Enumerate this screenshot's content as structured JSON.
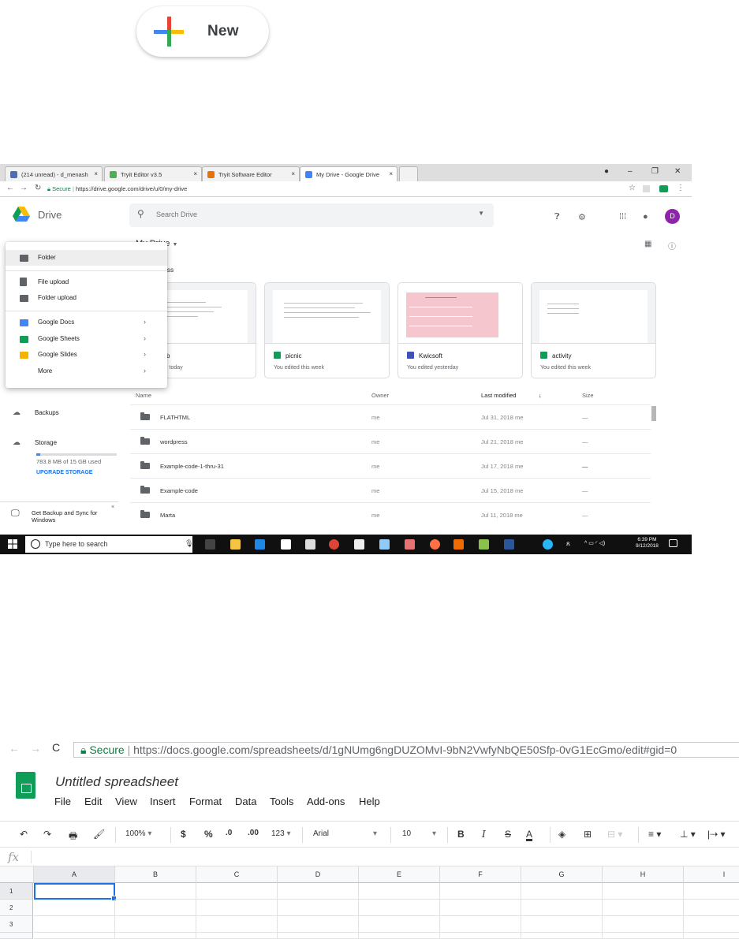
{
  "new_button": {
    "label": "New"
  },
  "drive": {
    "tabs": [
      {
        "label": "(214 unread) - d_menash",
        "color": "#4a6ebd"
      },
      {
        "label": "Tryit Editor v3.5",
        "color": "#4caf50"
      },
      {
        "label": "Tryit Software Editor",
        "color": "#e8710a"
      },
      {
        "label": "My Drive - Google Drive",
        "color": "#4285f4"
      }
    ],
    "address": {
      "secure": "Secure",
      "url": "https://drive.google.com/drive/u/0/my-drive"
    },
    "app_title": "Drive",
    "search_placeholder": "Search Drive",
    "avatar_letter": "D",
    "breadcrumb": "My Drive",
    "quick_access": "ess",
    "new_menu": {
      "folder": "Folder",
      "file_upload": "File upload",
      "folder_upload": "Folder upload",
      "google_docs": "Google Docs",
      "google_sheets": "Google Sheets",
      "google_slides": "Google Slides",
      "more": "More"
    },
    "cards": [
      {
        "name": "b",
        "edited": "l today",
        "color": "#4285f4"
      },
      {
        "name": "picnic",
        "edited": "You edited this week",
        "color": "#0f9d58"
      },
      {
        "name": "Kwicsoft",
        "edited": "You edited yesterday",
        "color": "#3f51b5"
      },
      {
        "name": "activity",
        "edited": "You edited this week",
        "color": "#0f9d58"
      }
    ],
    "sidebar": {
      "backups": "Backups",
      "storage": "Storage",
      "storage_used": "783.8 MB of 15 GB used",
      "storage_fraction": 0.05,
      "upgrade": "UPGRADE STORAGE",
      "backup_promo": "Get Backup and Sync for Windows"
    },
    "columns": {
      "name": "Name",
      "owner": "Owner",
      "last_modified": "Last modified",
      "size": "Size"
    },
    "files": [
      {
        "name": "FLATHTML",
        "owner": "me",
        "modified": "Jul 31, 2018 me",
        "size": "—"
      },
      {
        "name": "wordpress",
        "owner": "me",
        "modified": "Jul 21, 2018 me",
        "size": "—"
      },
      {
        "name": "Example-code-1-thru-31",
        "owner": "me",
        "modified": "Jul 17, 2018 me",
        "size": "—"
      },
      {
        "name": "Example-code",
        "owner": "me",
        "modified": "Jul 15, 2018 me",
        "size": "—"
      },
      {
        "name": "Marta",
        "owner": "me",
        "modified": "Jul 11, 2018 me",
        "size": "—"
      }
    ],
    "taskbar": {
      "search": "Type here to search",
      "time": "6:39 PM",
      "date": "9/12/2018"
    }
  },
  "sheets": {
    "address": {
      "secure": "Secure",
      "url": "https://docs.google.com/spreadsheets/d/1gNUmg6ngDUZOMvI-9bN2VwfyNbQE50Sfp-0vG1EcGmo/edit#gid=0"
    },
    "title": "Untitled spreadsheet",
    "menu": [
      "File",
      "Edit",
      "View",
      "Insert",
      "Format",
      "Data",
      "Tools",
      "Add-ons",
      "Help"
    ],
    "toolbar": {
      "zoom": "100%",
      "currency": "$",
      "percent": "%",
      "dec_less": ".0",
      "dec_more": ".00",
      "format": "123",
      "font": "Arial",
      "font_size": "10",
      "bold": "B",
      "italic": "I",
      "strike": "S",
      "text_color": "A"
    },
    "fx": "fx",
    "columns": [
      "A",
      "B",
      "C",
      "D",
      "E",
      "F",
      "G",
      "H",
      "I"
    ],
    "rows": [
      "1",
      "2",
      "3"
    ]
  }
}
